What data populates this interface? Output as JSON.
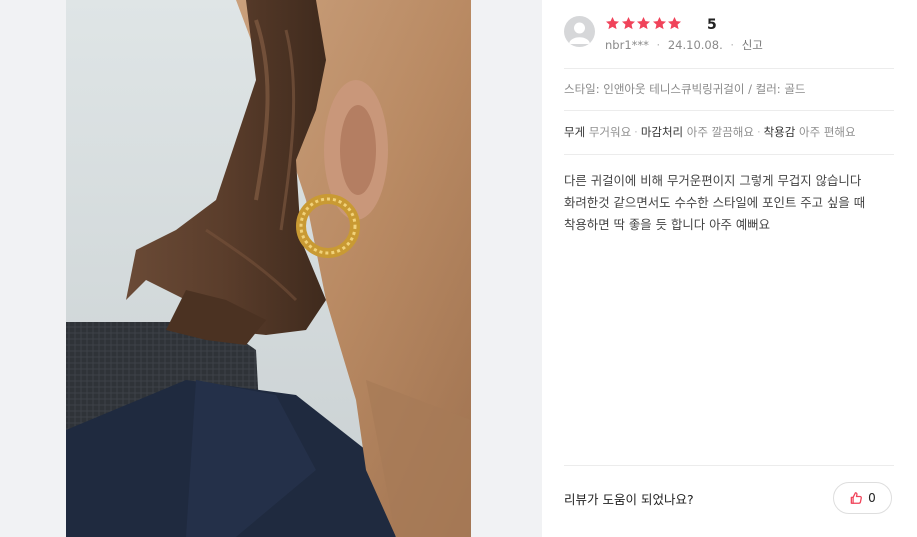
{
  "review": {
    "rating": "5",
    "stars": 5,
    "author": "nbr1***",
    "date": "24.10.08.",
    "report_label": "신고",
    "option_text": "스타일: 인앤아웃 테니스큐빅링귀걸이 / 컬러: 골드",
    "evaluations": [
      {
        "key": "무게",
        "value": "무거워요"
      },
      {
        "key": "마감처리",
        "value": "아주 깔끔해요"
      },
      {
        "key": "착용감",
        "value": "아주 편해요"
      }
    ],
    "body_lines": [
      "다른 귀걸이에 비해 무거운편이지 그렇게 무겁지 않습니다",
      "화려한것 같으면서도 수수한 스타일에 포인트 주고 싶을 때",
      "착용하면 딱 좋을 듯 합니다 아주 예뻐요"
    ]
  },
  "helpful": {
    "question": "리뷰가 도움이 되었나요?",
    "count": "0"
  },
  "colors": {
    "star": "#f0435a",
    "page_bg": "#f1f2f4"
  }
}
